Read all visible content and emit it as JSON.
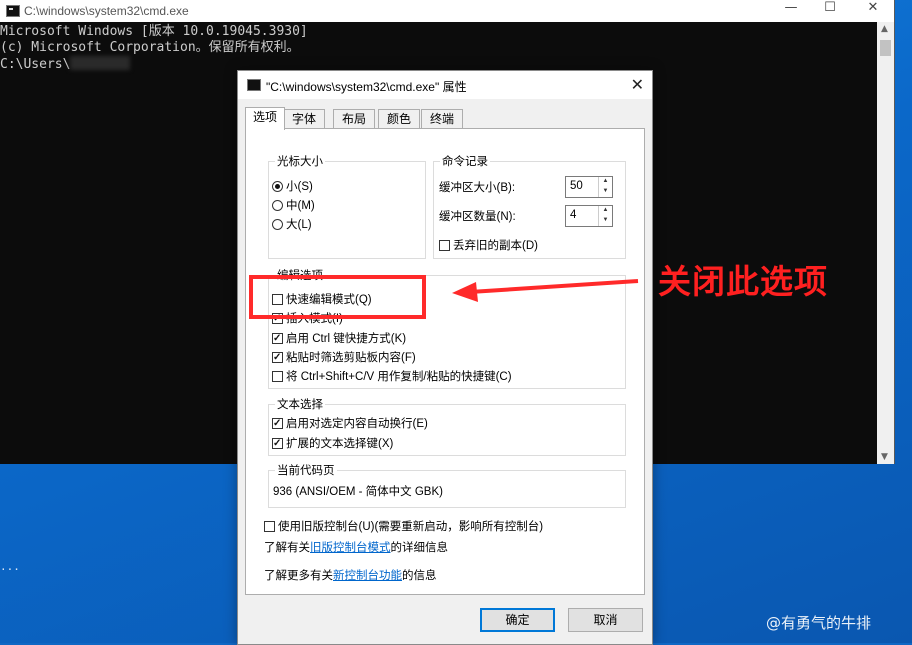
{
  "cmd": {
    "title": "C:\\windows\\system32\\cmd.exe",
    "lines": [
      "Microsoft Windows [版本 10.0.19045.3930]",
      "(c) Microsoft Corporation。保留所有权利。",
      "",
      "C:\\Users\\"
    ],
    "minimize": "—",
    "maximize": "☐",
    "close": "✕"
  },
  "dialog": {
    "title": "\"C:\\windows\\system32\\cmd.exe\" 属性",
    "close": "✕",
    "tabs": [
      "选项",
      "字体",
      "布局",
      "颜色",
      "终端"
    ],
    "cursor_size": {
      "label": "光标大小",
      "options": [
        {
          "label": "小(S)",
          "selected": true
        },
        {
          "label": "中(M)",
          "selected": false
        },
        {
          "label": "大(L)",
          "selected": false
        }
      ]
    },
    "command_history": {
      "label": "命令记录",
      "buffer_size_label": "缓冲区大小(B):",
      "buffer_size_value": "50",
      "buffer_count_label": "缓冲区数量(N):",
      "buffer_count_value": "4",
      "discard_label": "丢弃旧的副本(D)",
      "discard_checked": false
    },
    "edit_options": {
      "label": "编辑选项",
      "items": [
        {
          "label": "快速编辑模式(Q)",
          "checked": false
        },
        {
          "label": "插入模式(I)",
          "checked": true
        },
        {
          "label": "启用 Ctrl 键快捷方式(K)",
          "checked": true
        },
        {
          "label": "粘贴时筛选剪贴板内容(F)",
          "checked": true
        },
        {
          "label": "将 Ctrl+Shift+C/V 用作复制/粘贴的快捷键(C)",
          "checked": false
        }
      ]
    },
    "text_selection": {
      "label": "文本选择",
      "items": [
        {
          "label": "启用对选定内容自动换行(E)",
          "checked": true
        },
        {
          "label": "扩展的文本选择键(X)",
          "checked": true
        }
      ]
    },
    "codepage": {
      "label": "当前代码页",
      "value": "936   (ANSI/OEM - 简体中文 GBK)"
    },
    "legacy": {
      "label": "使用旧版控制台(U)(需要重新启动，影响所有控制台)",
      "checked": false,
      "info_prefix": "了解有关",
      "info_link": "旧版控制台模式",
      "info_suffix": "的详细信息",
      "more_prefix": "了解更多有关",
      "more_link": "新控制台功能",
      "more_suffix": "的信息"
    },
    "ok_label": "确定",
    "cancel_label": "取消"
  },
  "annotation": {
    "text": "关闭此选项",
    "color": "#ff2020"
  },
  "desktop": {
    "side_glyph": "..."
  },
  "watermark": "@有勇气的牛排"
}
